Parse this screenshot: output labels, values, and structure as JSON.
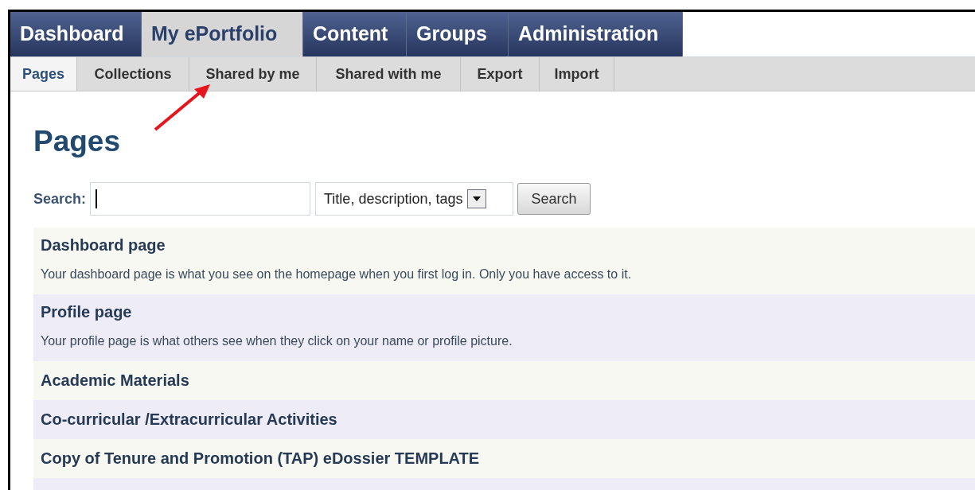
{
  "main_nav": [
    {
      "label": "Dashboard",
      "selected": false
    },
    {
      "label": "My ePortfolio",
      "selected": true
    },
    {
      "label": "Content",
      "selected": false
    },
    {
      "label": "Groups",
      "selected": false
    },
    {
      "label": "Administration",
      "selected": false
    }
  ],
  "sub_nav": [
    {
      "label": "Pages",
      "selected": true
    },
    {
      "label": "Collections",
      "selected": false
    },
    {
      "label": "Shared by me",
      "selected": false
    },
    {
      "label": "Shared with me",
      "selected": false
    },
    {
      "label": "Export",
      "selected": false
    },
    {
      "label": "Import",
      "selected": false
    }
  ],
  "heading": "Pages",
  "search": {
    "label": "Search:",
    "scope": "Title, description, tags",
    "button": "Search"
  },
  "pages": [
    {
      "title": "Dashboard page",
      "description": "Your dashboard page is what you see on the homepage when you first log in. Only you have access to it."
    },
    {
      "title": "Profile page",
      "description": "Your profile page is what others see when they click on your name or profile picture."
    },
    {
      "title": "Academic Materials"
    },
    {
      "title": "Co-curricular /Extracurricular Activities"
    },
    {
      "title": "Copy of Tenure and Promotion (TAP) eDossier TEMPLATE"
    }
  ]
}
